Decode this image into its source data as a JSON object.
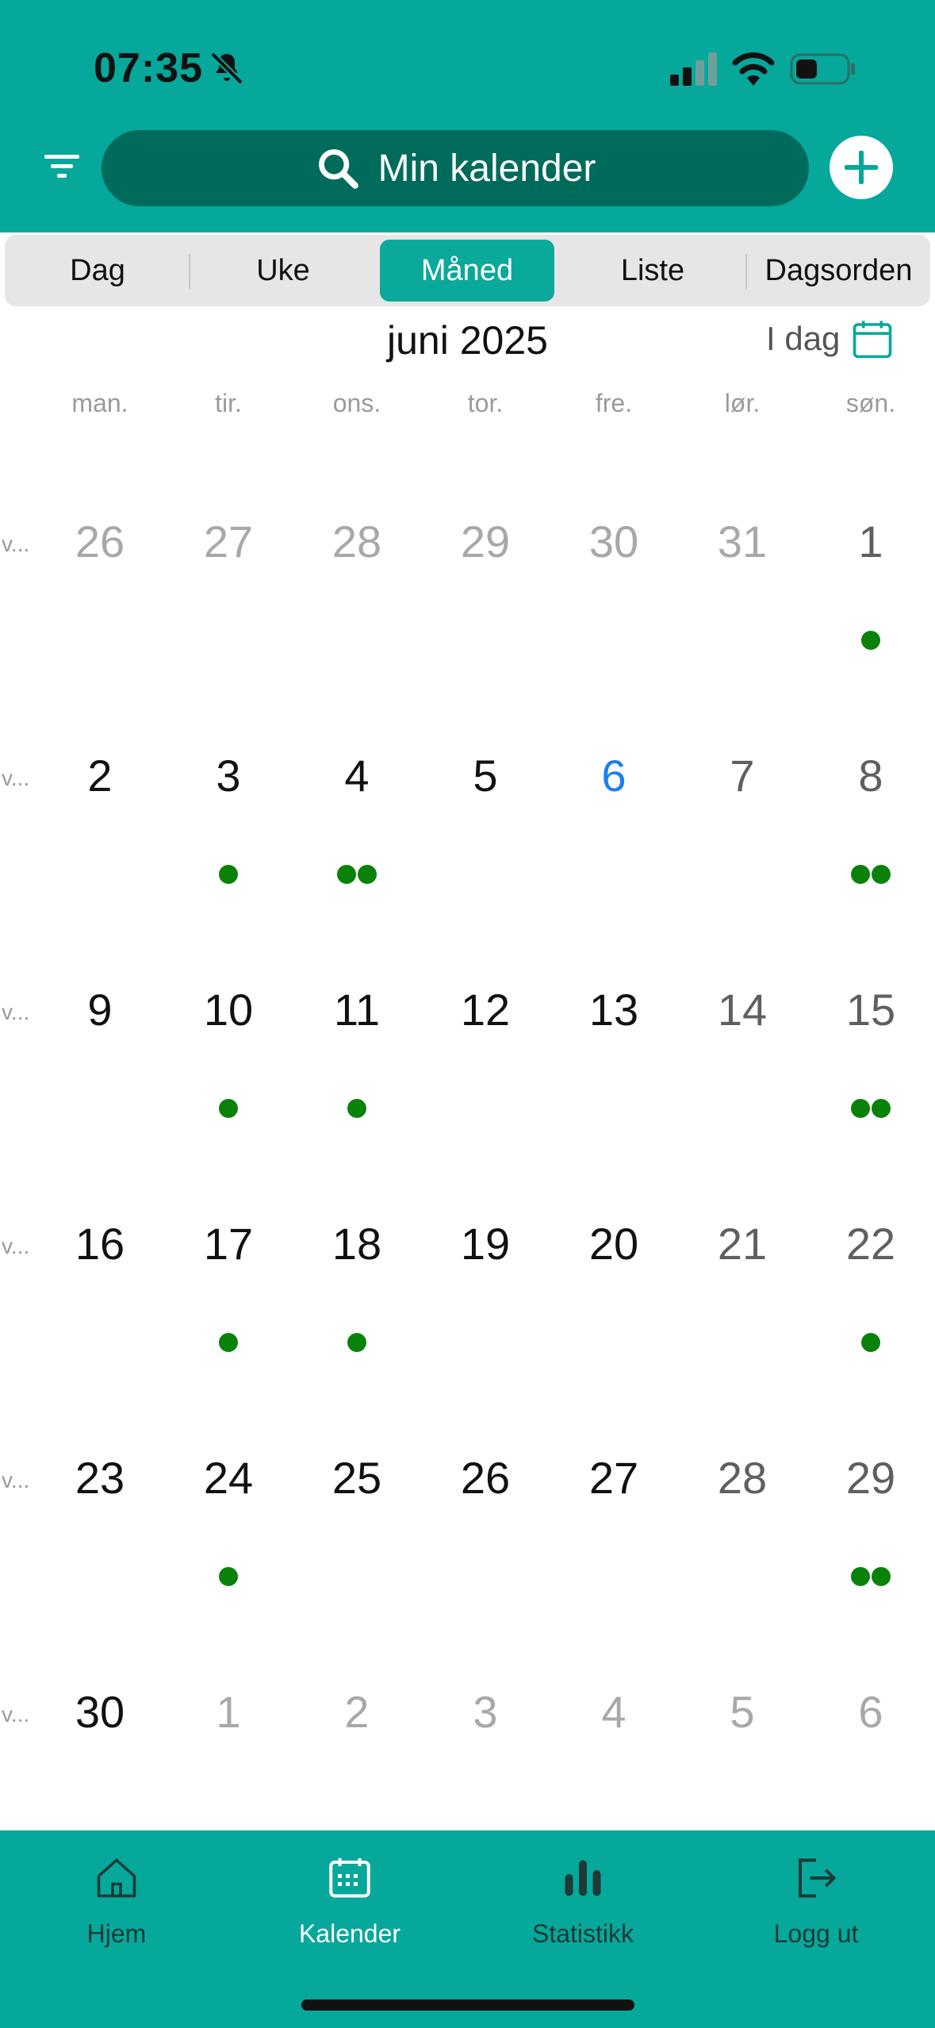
{
  "status_bar": {
    "time": "07:35"
  },
  "header": {
    "title": "Min kalender"
  },
  "view_tabs": [
    "Dag",
    "Uke",
    "Måned",
    "Liste",
    "Dagsorden"
  ],
  "active_view": "Måned",
  "calendar": {
    "month_title": "juni 2025",
    "today_label": "I dag",
    "weekdays": [
      "man.",
      "tir.",
      "ons.",
      "tor.",
      "fre.",
      "lør.",
      "søn."
    ],
    "week_label": "v...",
    "weeks": [
      {
        "days": [
          {
            "n": "26",
            "t": "other"
          },
          {
            "n": "27",
            "t": "other"
          },
          {
            "n": "28",
            "t": "other"
          },
          {
            "n": "29",
            "t": "other"
          },
          {
            "n": "30",
            "t": "other"
          },
          {
            "n": "31",
            "t": "other"
          },
          {
            "n": "1",
            "t": "weekend",
            "dots": 1
          }
        ]
      },
      {
        "days": [
          {
            "n": "2",
            "t": "normal"
          },
          {
            "n": "3",
            "t": "normal",
            "dots": 1
          },
          {
            "n": "4",
            "t": "normal",
            "dots": 2
          },
          {
            "n": "5",
            "t": "normal"
          },
          {
            "n": "6",
            "t": "today"
          },
          {
            "n": "7",
            "t": "weekend"
          },
          {
            "n": "8",
            "t": "weekend",
            "dots": 2
          }
        ]
      },
      {
        "days": [
          {
            "n": "9",
            "t": "normal"
          },
          {
            "n": "10",
            "t": "normal",
            "dots": 1
          },
          {
            "n": "11",
            "t": "normal",
            "dots": 1
          },
          {
            "n": "12",
            "t": "normal"
          },
          {
            "n": "13",
            "t": "normal"
          },
          {
            "n": "14",
            "t": "weekend"
          },
          {
            "n": "15",
            "t": "weekend",
            "dots": 2
          }
        ]
      },
      {
        "days": [
          {
            "n": "16",
            "t": "normal"
          },
          {
            "n": "17",
            "t": "normal",
            "dots": 1
          },
          {
            "n": "18",
            "t": "normal",
            "dots": 1
          },
          {
            "n": "19",
            "t": "normal"
          },
          {
            "n": "20",
            "t": "normal"
          },
          {
            "n": "21",
            "t": "weekend"
          },
          {
            "n": "22",
            "t": "weekend",
            "dots": 1
          }
        ]
      },
      {
        "days": [
          {
            "n": "23",
            "t": "normal"
          },
          {
            "n": "24",
            "t": "normal",
            "dots": 1
          },
          {
            "n": "25",
            "t": "normal"
          },
          {
            "n": "26",
            "t": "normal"
          },
          {
            "n": "27",
            "t": "normal"
          },
          {
            "n": "28",
            "t": "weekend"
          },
          {
            "n": "29",
            "t": "weekend",
            "dots": 2
          }
        ]
      },
      {
        "days": [
          {
            "n": "30",
            "t": "normal"
          },
          {
            "n": "1",
            "t": "other"
          },
          {
            "n": "2",
            "t": "other"
          },
          {
            "n": "3",
            "t": "other"
          },
          {
            "n": "4",
            "t": "other"
          },
          {
            "n": "5",
            "t": "other"
          },
          {
            "n": "6",
            "t": "other"
          }
        ]
      }
    ]
  },
  "tab_bar": [
    {
      "label": "Hjem",
      "icon": "home-icon",
      "active": false
    },
    {
      "label": "Kalender",
      "icon": "calendar-icon",
      "active": true
    },
    {
      "label": "Statistikk",
      "icon": "bar-chart-icon",
      "active": false
    },
    {
      "label": "Logg ut",
      "icon": "logout-icon",
      "active": false
    }
  ],
  "colors": {
    "teal": "#05a89a",
    "search_bg": "#006b5b",
    "active_segment": "#0aa99b",
    "event_dot": "#0a820a",
    "today": "#1a7ef0"
  }
}
